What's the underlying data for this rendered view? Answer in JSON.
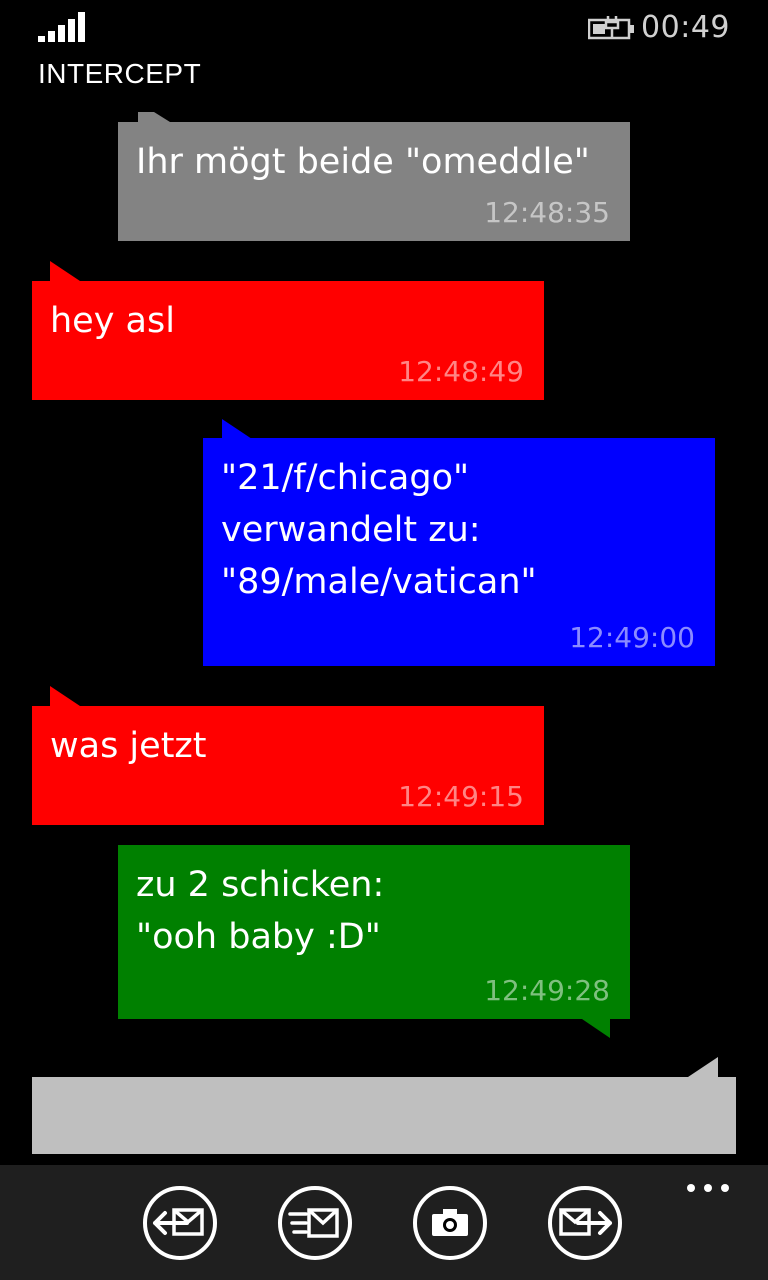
{
  "status_bar": {
    "time": "00:49"
  },
  "app": {
    "title": "INTERCEPT"
  },
  "messages": [
    {
      "text": "Ihr mögt beide  \"omeddle\"",
      "time": "12:48:35",
      "color": "#838383"
    },
    {
      "text": "hey asl",
      "time": "12:48:49",
      "color": "#ff0000"
    },
    {
      "text": "\"21/f/chicago\"\nverwandelt zu:\n\"89/male/vatican\"",
      "time": "12:49:00",
      "color": "#0000ff"
    },
    {
      "text": "was jetzt",
      "time": "12:49:15",
      "color": "#ff0000"
    },
    {
      "text": "zu 2 schicken:\n\"ooh baby :D\"",
      "time": "12:49:28",
      "color": "#008000"
    }
  ],
  "compose": {
    "value": ""
  },
  "app_bar": {
    "buttons": [
      {
        "icon": "receive-message-icon"
      },
      {
        "icon": "send-message-icon"
      },
      {
        "icon": "camera-icon"
      },
      {
        "icon": "forward-message-icon"
      }
    ],
    "more_icon": "more-dots-icon"
  }
}
